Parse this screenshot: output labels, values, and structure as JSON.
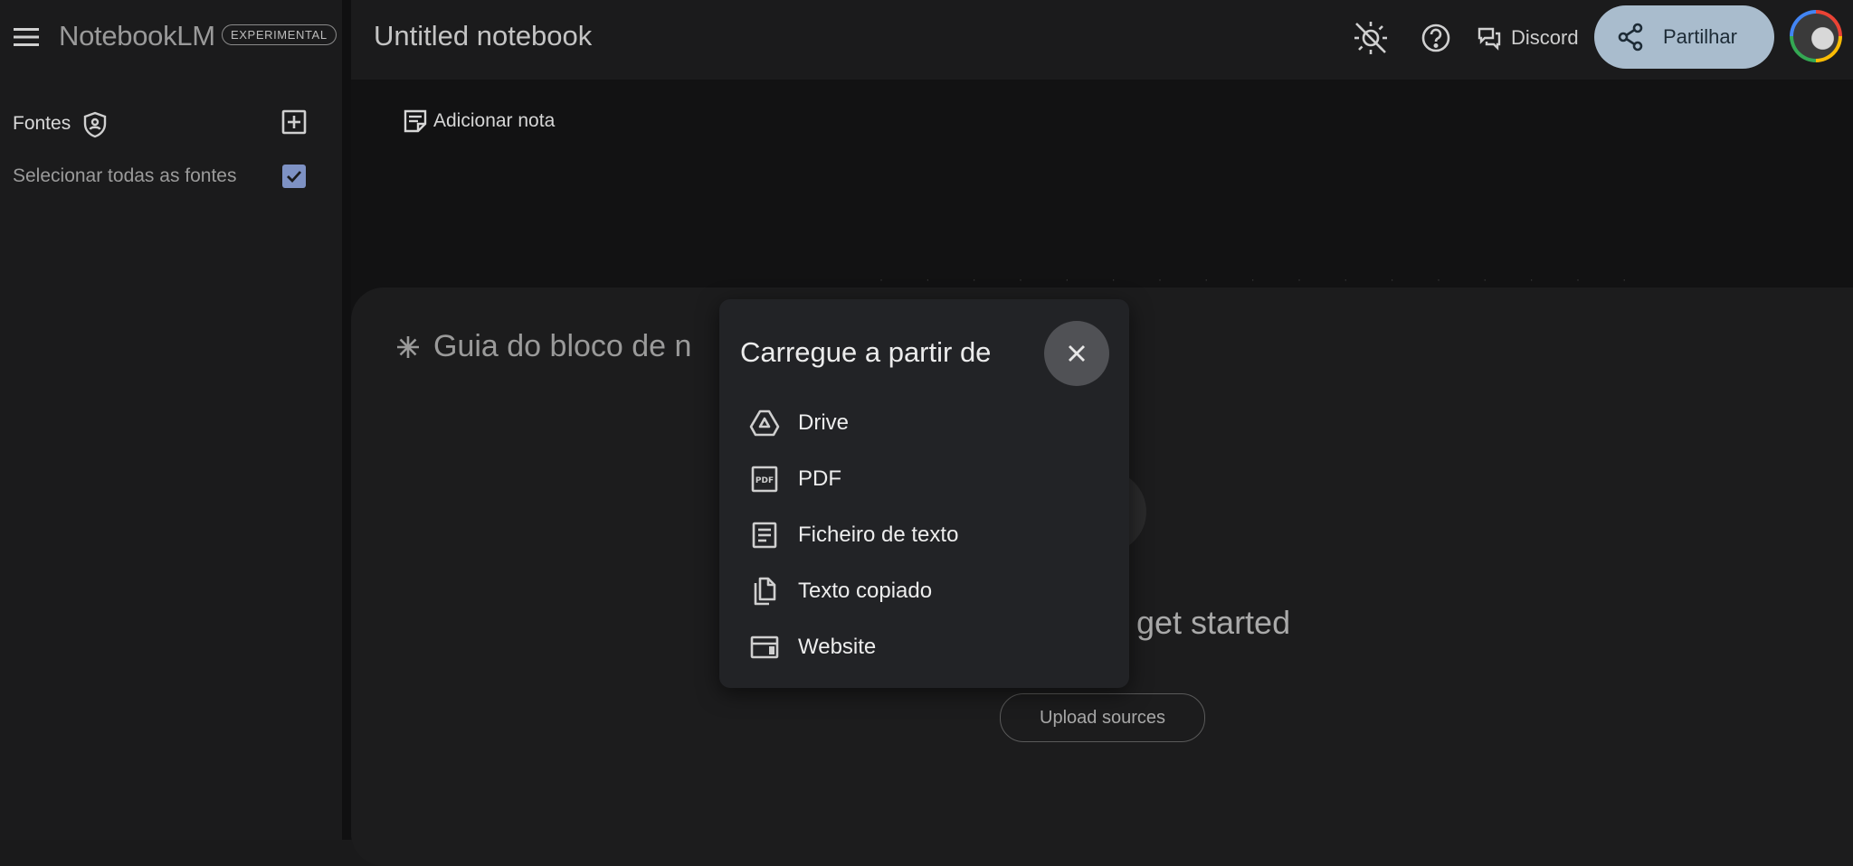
{
  "header": {
    "app_name": "NotebookLM",
    "badge": "EXPERIMENTAL",
    "notebook_title": "Untitled notebook",
    "discord_label": "Discord",
    "share_label": "Partilhar"
  },
  "sidebar": {
    "title": "Fontes",
    "select_all_label": "Selecionar todas as fontes",
    "select_all_checked": true
  },
  "main": {
    "add_note_label": "Adicionar nota",
    "guide_title": "Guia do bloco de n",
    "get_started_text": "get started",
    "upload_label": "Upload sources"
  },
  "modal": {
    "title": "Carregue a partir de",
    "options": [
      {
        "label": "Drive",
        "icon": "drive-icon"
      },
      {
        "label": "PDF",
        "icon": "pdf-icon"
      },
      {
        "label": "Ficheiro de texto",
        "icon": "text-file-icon"
      },
      {
        "label": "Texto copiado",
        "icon": "copy-icon"
      },
      {
        "label": "Website",
        "icon": "website-icon"
      }
    ]
  },
  "colors": {
    "background": "#1a1a1b",
    "main_background": "#121213",
    "share_button": "#a9bccd",
    "checkbox": "#7e92c4",
    "modal": "#222326"
  }
}
